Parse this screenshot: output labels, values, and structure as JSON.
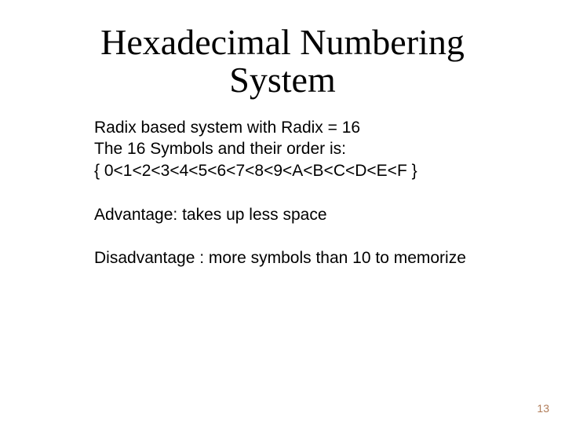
{
  "title": "Hexadecimal Numbering System",
  "body": {
    "line1": "Radix based system with Radix = 16",
    "line2": "The 16 Symbols and their order is:",
    "line3": "{ 0<1<2<3<4<5<6<7<8<9<A<B<C<D<E<F }",
    "line4": "Advantage: takes up less space",
    "line5": "Disadvantage : more symbols than 10 to memorize"
  },
  "page_number": "13"
}
